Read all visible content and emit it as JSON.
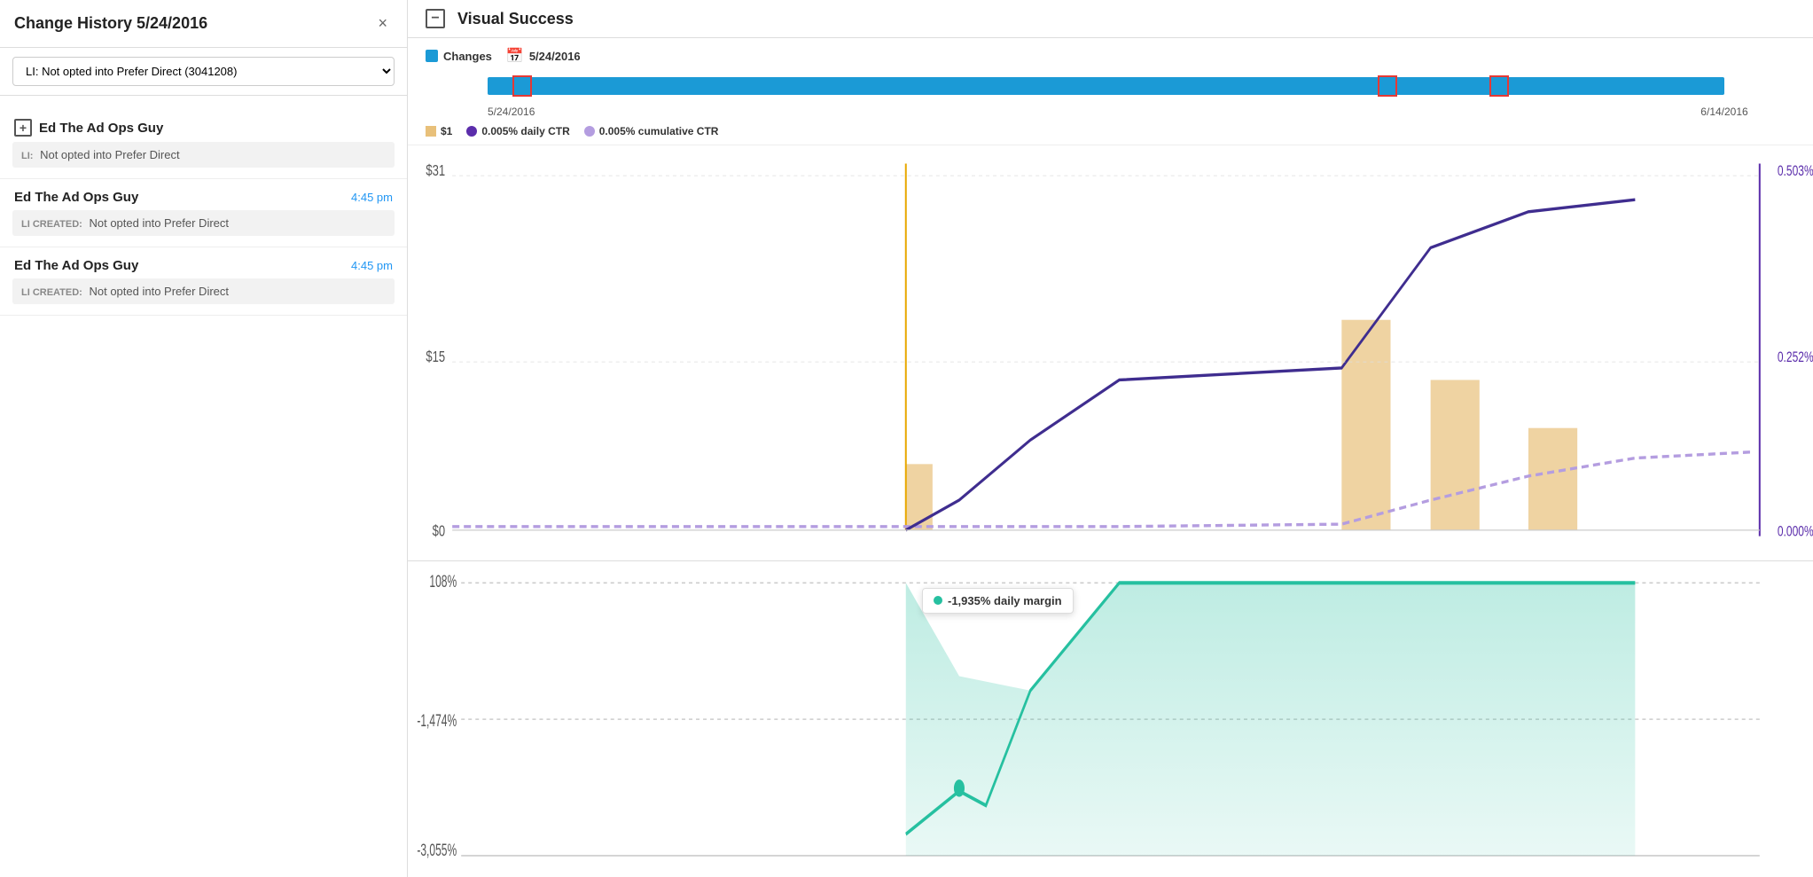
{
  "leftPanel": {
    "changeHistoryTitle": "Change History 5/24/2016",
    "closeBtn": "×",
    "dropdown": {
      "selected": "LI: Not opted into Prefer Direct (3041208)",
      "options": [
        "LI: Not opted into Prefer Direct (3041208)"
      ]
    },
    "entries": [
      {
        "showPlus": true,
        "user": "Ed The Ad Ops Guy",
        "time": "",
        "labelType": "LI:",
        "body": "Not opted into Prefer Direct"
      },
      {
        "showPlus": false,
        "user": "Ed The Ad Ops Guy",
        "time": "4:45 pm",
        "labelType": "LI CREATED:",
        "body": "Not opted into Prefer Direct"
      },
      {
        "showPlus": false,
        "user": "Ed The Ad Ops Guy",
        "time": "4:45 pm",
        "labelType": "LI CREATED:",
        "body": "Not opted into Prefer Direct"
      }
    ]
  },
  "mainPanel": {
    "title": "Visual Success",
    "minusBtn": "−",
    "legend": {
      "changesLabel": "Changes",
      "dateLabel": "5/24/2016"
    },
    "timeline": {
      "startDate": "5/24/2016",
      "endDate": "6/14/2016",
      "markers": [
        {
          "leftPercent": 2
        },
        {
          "leftPercent": 72
        },
        {
          "leftPercent": 82
        }
      ]
    },
    "ctrChart": {
      "legend": [
        {
          "type": "square-orange",
          "label": "$1"
        },
        {
          "type": "dot-purple",
          "color": "#5b2dab",
          "label": "0.005% daily CTR"
        },
        {
          "type": "dot-lavender",
          "color": "#b49de0",
          "label": "0.005% cumulative CTR"
        }
      ],
      "yAxisLabels": [
        "$31",
        "$15",
        "$0"
      ],
      "yAxisRight": [
        "0.503% CTR",
        "0.252% CTR",
        "0.000% CTR"
      ]
    },
    "tooltip": {
      "margin": "-1,935% daily margin"
    },
    "marginChart": {
      "yAxisLabels": [
        "108%",
        "-1,474%",
        "-3,055%"
      ]
    }
  }
}
